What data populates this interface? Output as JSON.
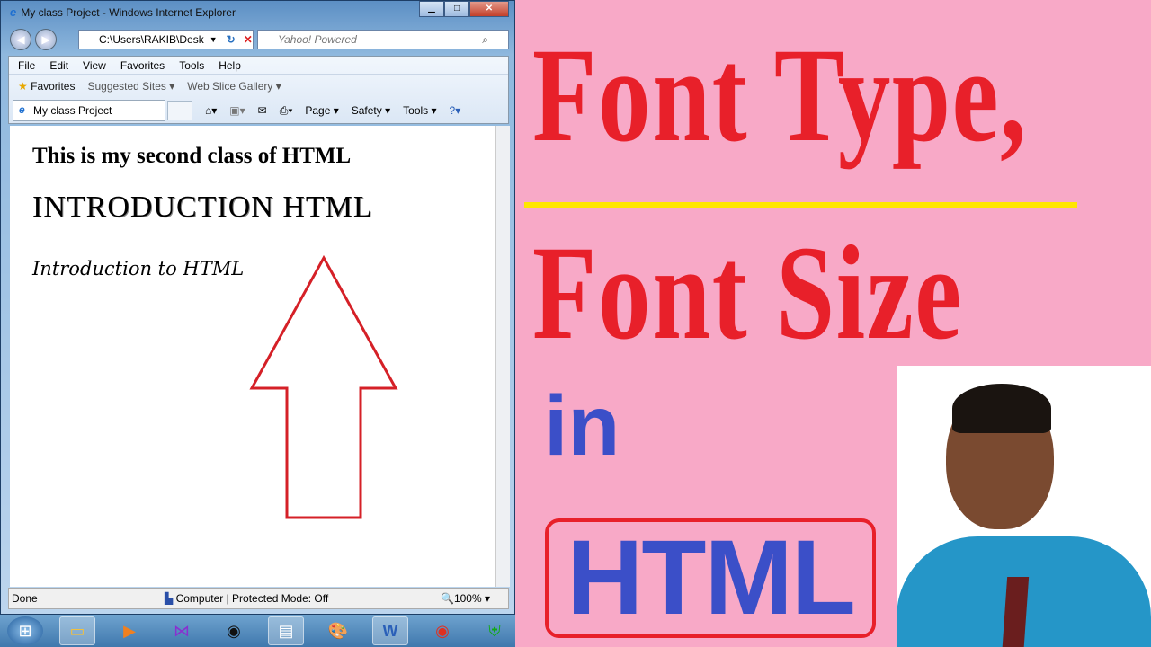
{
  "window": {
    "title": "My class Project - Windows Internet Explorer",
    "address": "C:\\Users\\RAKIB\\Desk",
    "search_placeholder": "Yahoo! Powered"
  },
  "menu": [
    "File",
    "Edit",
    "View",
    "Favorites",
    "Tools",
    "Help"
  ],
  "favorites": {
    "label": "Favorites",
    "items": [
      "Suggested Sites ▾",
      "Web Slice Gallery ▾"
    ]
  },
  "tab": {
    "label": "My class Project"
  },
  "commands": [
    "Page ▾",
    "Safety ▾",
    "Tools ▾"
  ],
  "page": {
    "line1": "This is my second class of HTML",
    "line2": "INTRODUCTION HTML",
    "line3": "Introduction to HTML"
  },
  "status": {
    "text": "Done",
    "zone": "Computer | Protected Mode: Off",
    "zoom": "100%"
  },
  "thumbnail": {
    "line1": "Font Type,",
    "line2": "Font Size",
    "line3": "in",
    "line4": "HTML",
    "title_color": "#e8202a",
    "accent_color": "#3b4fc8",
    "underline_color": "#ffe600",
    "background": "#f8a9c7"
  }
}
